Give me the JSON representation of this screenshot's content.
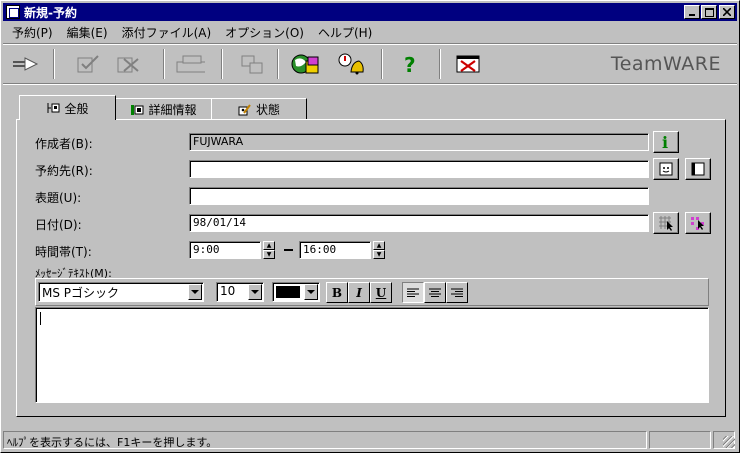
{
  "window": {
    "title": "新規-予約"
  },
  "menu": [
    "予約(P)",
    "編集(E)",
    "添付ファイル(A)",
    "オプション(O)",
    "ヘルプ(H)"
  ],
  "toolbar": {
    "brand": "TeamWARE",
    "tools": [
      "send-icon",
      "check-icon",
      "delete-icon",
      "print-icon",
      "attach-icon",
      "schedule-icon",
      "alarm-icon",
      "help-icon",
      "close-icon"
    ]
  },
  "tabs": [
    {
      "label": "全般",
      "icon": "general-icon",
      "active": true
    },
    {
      "label": "詳細情報",
      "icon": "details-icon",
      "active": false
    },
    {
      "label": "状態",
      "icon": "status-icon",
      "active": false
    }
  ],
  "form": {
    "author_label": "作成者(B):",
    "author_value": "FUJWARA",
    "dest_label": "予約先(R):",
    "dest_value": "",
    "subject_label": "表題(U):",
    "subject_value": "",
    "date_label": "日付(D):",
    "date_value": "98/01/14",
    "time_label": "時間帯(T):",
    "time_start": "9:00",
    "time_end": "16:00",
    "message_label": "ﾒｯｾｰｼﾞﾃｷｽﾄ(M):"
  },
  "format": {
    "font": "MS Pゴシック",
    "size": "10",
    "color": "#000000",
    "bold": "B",
    "italic": "I",
    "underline": "U"
  },
  "message_text": "",
  "status": {
    "text": "ﾍﾙﾌﾟを表示するには、F1キーを押します。"
  }
}
